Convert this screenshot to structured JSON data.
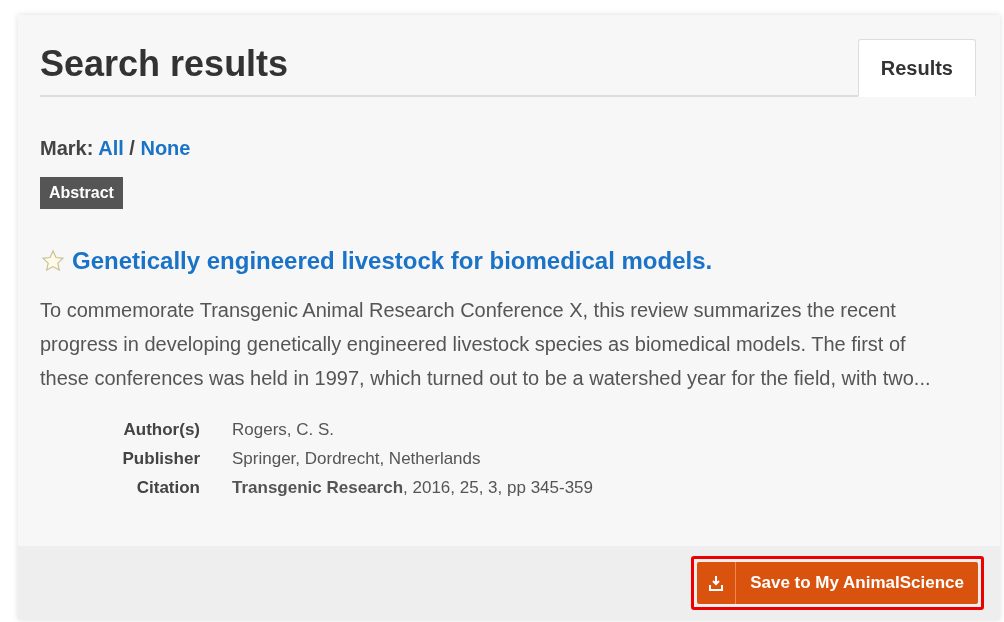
{
  "header": {
    "title": "Search results"
  },
  "tabs": [
    {
      "label": "Results",
      "selected": true
    }
  ],
  "mark": {
    "label": "Mark:",
    "links": [
      "All",
      "None"
    ],
    "separator": "/"
  },
  "filter_badge": "Abstract",
  "result": {
    "title": "Genetically engineered livestock for biomedical models.",
    "starred": false,
    "abstract": "To commemorate Transgenic Animal Research Conference X, this review summarizes the recent progress in developing genetically engineered livestock species as biomedical models. The first of these conferences was held in 1997, which turned out to be a watershed year for the field, with two...",
    "details": [
      {
        "label": "Author(s)",
        "value": "Rogers, C. S."
      },
      {
        "label": "Publisher",
        "value": "Springer, Dordrecht, Netherlands"
      },
      {
        "label": "Citation",
        "value": "**Transgenic Research**, 2016, 25, 3, pp 345-359"
      }
    ]
  },
  "save_button": {
    "label": "Save to My AnimalScience",
    "highlighted": true
  }
}
